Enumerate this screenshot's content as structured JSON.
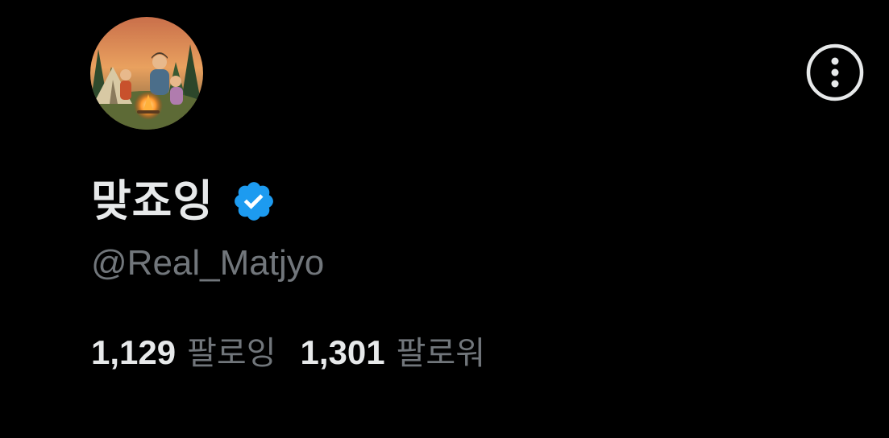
{
  "profile": {
    "display_name": "맞죠잉",
    "handle": "@Real_Matjyo",
    "verified": true,
    "avatar_icon": "avatar-image",
    "verified_icon": "verified-badge-icon",
    "more_icon": "more-options-icon"
  },
  "stats": {
    "following_count": "1,129",
    "following_label": "팔로잉",
    "followers_count": "1,301",
    "followers_label": "팔로워"
  },
  "colors": {
    "background": "#000000",
    "primary_text": "#e7e9ea",
    "secondary_text": "#71767b",
    "verified_blue": "#1d9bf0"
  }
}
